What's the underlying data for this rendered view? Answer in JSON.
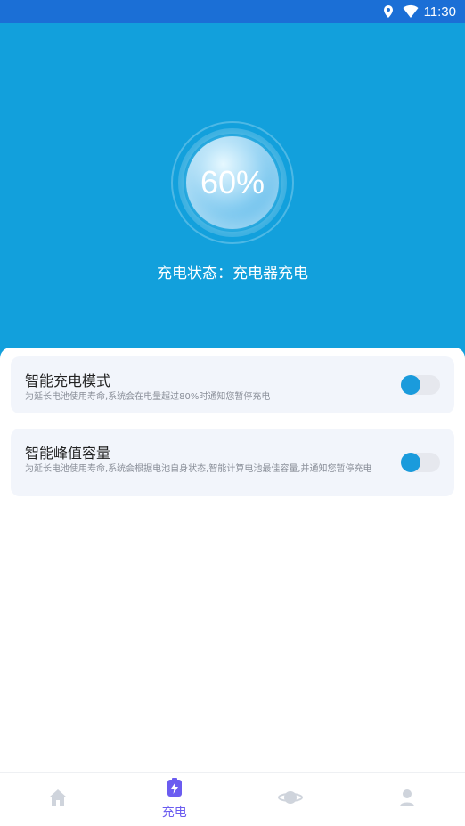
{
  "status_bar": {
    "time": "11:30"
  },
  "hero": {
    "battery_percent": "60%",
    "charge_status": "充电状态：充电器充电"
  },
  "settings": [
    {
      "title": "智能充电模式",
      "description": "为延长电池使用寿命,系统会在电量超过80%时通知您暂停充电",
      "enabled": false
    },
    {
      "title": "智能峰值容量",
      "description": "为延长电池使用寿命,系统会根据电池自身状态,智能计算电池最佳容量,并通知您暂停充电",
      "enabled": false
    }
  ],
  "bottom_nav": {
    "items": [
      {
        "icon": "home-icon",
        "label": ""
      },
      {
        "icon": "battery-charging-icon",
        "label": "充电",
        "active": true
      },
      {
        "icon": "planet-icon",
        "label": ""
      },
      {
        "icon": "user-icon",
        "label": ""
      }
    ]
  },
  "colors": {
    "status_bar": "#1b6fd6",
    "hero": "#12a0dc",
    "toggle_knob": "#1a9bdc",
    "active_nav": "#6b5cf0"
  }
}
